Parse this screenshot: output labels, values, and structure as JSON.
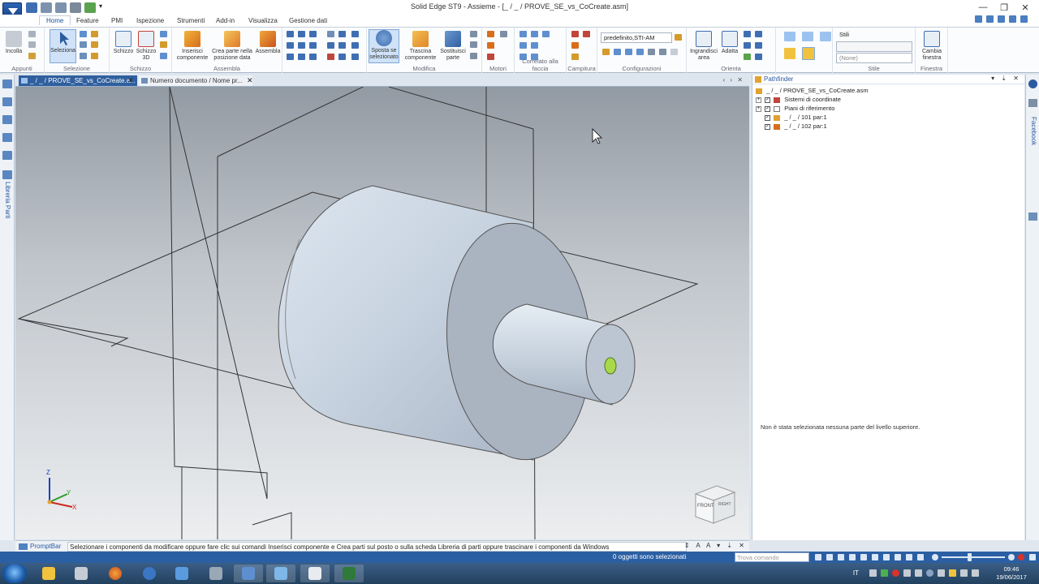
{
  "window": {
    "title": "Solid Edge ST9 - Assieme - [_ / _ / PROVE_SE_vs_CoCreate.asm]",
    "controls": [
      "?",
      "—",
      "❐",
      "✕"
    ]
  },
  "ribbon_tabs": [
    "Home",
    "Feature",
    "PMI",
    "Ispezione",
    "Strumenti",
    "Add-in",
    "Visualizza",
    "Gestione dati"
  ],
  "ribbon": {
    "groups": {
      "appunti": "Appunti",
      "selezione": "Selezione",
      "schizzo": "Schizzo",
      "assembla": "Assembla",
      "modifica": "Modifica",
      "motori": "Motori",
      "correlato": "Correlato alla faccia",
      "campitura": "Campitura",
      "configurazioni": "Configurazioni",
      "orienta": "Orienta",
      "stile": "Stile",
      "finestra": "Finestra"
    },
    "buttons": {
      "incolla": "Incolla",
      "seleziona": "Seleziona",
      "schizzo": "Schizzo",
      "schizzo3d_1": "Schizzo",
      "schizzo3d_2": "3D",
      "inserisci_1": "Inserisci",
      "inserisci_2": "componente",
      "crea_1": "Crea parte nella",
      "crea_2": "posizione data",
      "assembla": "Assembla",
      "sposta_1": "Sposta se",
      "sposta_2": "selezionato",
      "trascina_1": "Trascina",
      "trascina_2": "componente",
      "sostituisci_1": "Sostituisci",
      "sostituisci_2": "parte",
      "ingrandisci_1": "Ingrandisci",
      "ingrandisci_2": "area",
      "adatta": "Adatta",
      "cambia_1": "Cambia",
      "cambia_2": "finestra"
    },
    "config_combo": "predefinito,STI-AM",
    "style_label": "Stili",
    "style_combo": "(None)"
  },
  "doc_tabs": [
    {
      "label": "_ / _ / PROVE_SE_vs_CoCreate.a...",
      "close": "✕"
    },
    {
      "label": "Numero documento / Nome pr...",
      "close": "✕"
    }
  ],
  "left_panel_label": "Libreria Parti",
  "right_panel_label": "Facebook",
  "viewport": {
    "axis_labels": {
      "z": "Z",
      "y": "Y",
      "x": "X"
    },
    "view_cube": {
      "front": "FRONT",
      "right": "RIGHT"
    }
  },
  "pathfinder": {
    "title": "Pathfinder",
    "controls": "▾ ⇣ ✕",
    "tree": [
      {
        "label": "_ / _ / PROVE_SE_vs_CoCreate.asm",
        "level": 0
      },
      {
        "label": "Sistemi di coordinate",
        "level": 1
      },
      {
        "label": "Piani di riferimento",
        "level": 1
      },
      {
        "label": "_ / _ / 101 par:1",
        "level": 1
      },
      {
        "label": "_ / _ / 102 par:1",
        "level": 1
      }
    ],
    "message": "Non è stata selezionata nessuna parte del livello superiore."
  },
  "promptbar": {
    "label": "PromptBar",
    "text": "Selezionare i componenti da modificare oppure fare clic sui comandi Inserisci componente e Crea parti sul posto o sulla scheda Libreria di parti oppure trascinare i componenti da Windows",
    "controls": "⇕ A A ▾ ⇣ ✕"
  },
  "statusbar": {
    "selection": "0 oggetti sono selezionati",
    "find_placeholder": "Trova comando"
  },
  "taskbar": {
    "lang": "IT",
    "time": "09:46",
    "date": "19/06/2017"
  }
}
